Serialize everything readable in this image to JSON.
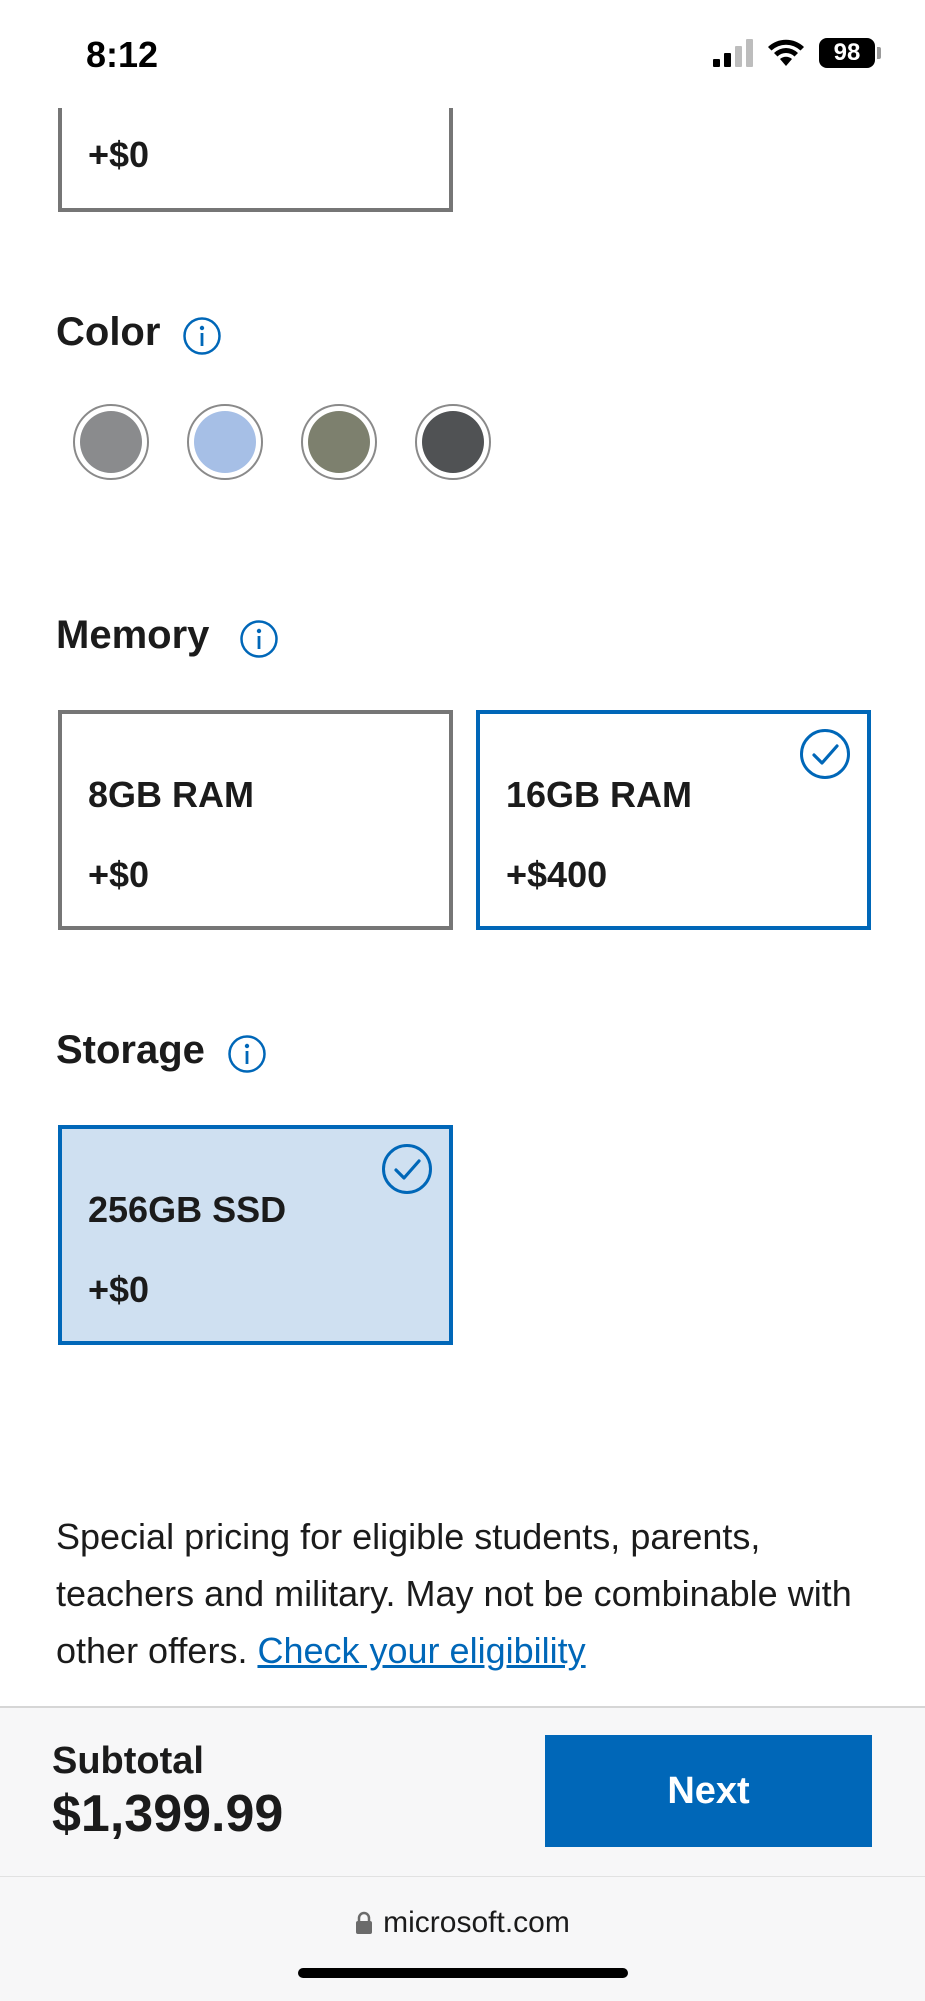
{
  "status_bar": {
    "time": "8:12",
    "battery": "98"
  },
  "top_card": {
    "price": "+$0"
  },
  "color": {
    "title": "Color",
    "swatches": [
      {
        "name": "platinum",
        "hex": "#8a8b8d"
      },
      {
        "name": "sapphire",
        "hex": "#a6bfe6"
      },
      {
        "name": "sage",
        "hex": "#7d806e"
      },
      {
        "name": "graphite",
        "hex": "#505254"
      }
    ]
  },
  "memory": {
    "title": "Memory",
    "options": [
      {
        "name": "8GB RAM",
        "price": "+$0",
        "selected": false
      },
      {
        "name": "16GB RAM",
        "price": "+$400",
        "selected": true
      }
    ]
  },
  "storage": {
    "title": "Storage",
    "options": [
      {
        "name": "256GB SSD",
        "price": "+$0",
        "selected": true
      }
    ]
  },
  "promo": {
    "text": "Special pricing for eligible students, parents, teachers and military. May not be combinable with other offers.",
    "link": "Check your eligibility"
  },
  "footer": {
    "subtotal_label": "Subtotal",
    "subtotal_value": "$1,399.99",
    "next_label": "Next"
  },
  "browser": {
    "url": "microsoft.com"
  },
  "colors": {
    "accent": "#0067b8",
    "selected_fill": "#cfe0f1",
    "border": "#767676"
  }
}
